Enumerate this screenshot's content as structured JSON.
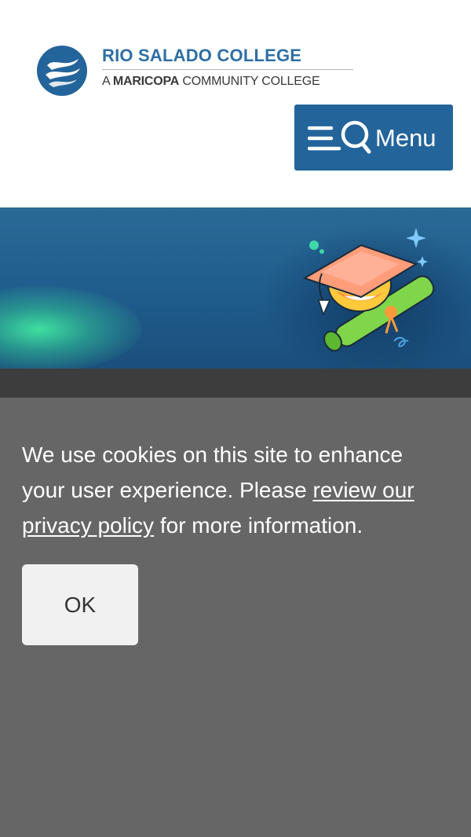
{
  "header": {
    "logo": {
      "name": "RIO SALADO COLLEGE",
      "tagline_prefix": "A",
      "tagline_bold": "MARICOPA",
      "tagline_rest": "COMMUNITY COLLEGE"
    },
    "menu_button": {
      "label": "Menu",
      "icon": "hamburger-search-icon"
    }
  },
  "hero": {
    "illustration": "graduation-cap-diploma-icon"
  },
  "cookie_banner": {
    "text_before_link": "We use cookies on this site to enhance your user experience. Please ",
    "link_text": "review our privacy policy",
    "text_after_link": " for more information.",
    "ok_label": "OK"
  },
  "colors": {
    "brand_blue": "#23649a",
    "logo_blue": "#2e6fa5",
    "cookie_bg": "#666666",
    "strip_bg": "#3d3d3d",
    "hero_glow": "#40e6a0"
  }
}
